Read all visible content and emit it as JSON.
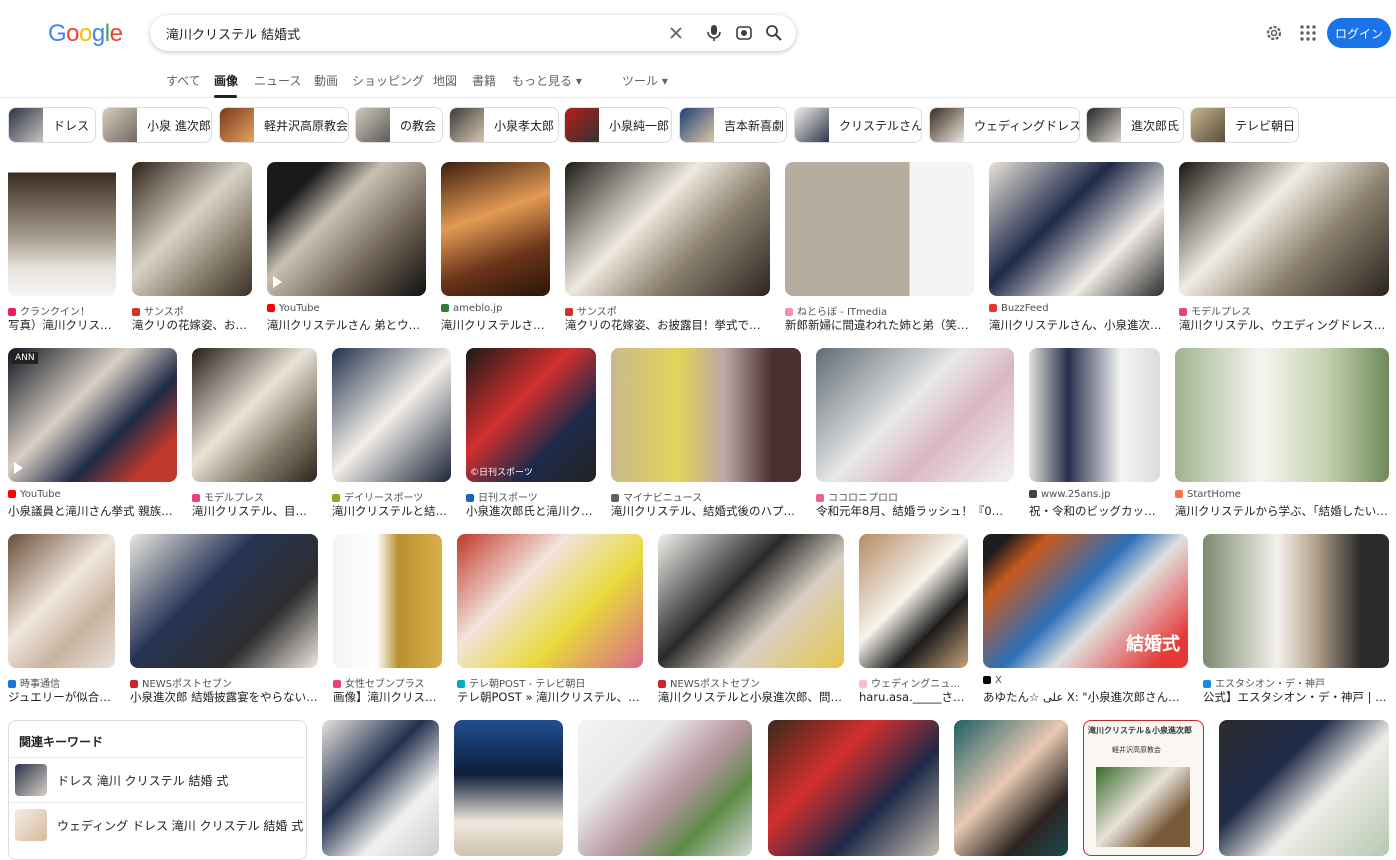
{
  "header": {
    "logo": "Google",
    "search_value": "滝川クリステル 結婚式",
    "login_label": "ログイン"
  },
  "tabs": [
    "すべて",
    "画像",
    "ニュース",
    "動画",
    "ショッピング",
    "地図",
    "書籍",
    "もっと見る ▾",
    "ツール ▾"
  ],
  "chips": [
    "ドレス",
    "小泉 進次郎",
    "軽井沢高原教会",
    "の教会",
    "小泉孝太郎",
    "小泉純一郎",
    "吉本新喜劇",
    "クリステルさん",
    "ウェディングドレス",
    "進次郎氏",
    "テレビ朝日"
  ],
  "results": {
    "row1": [
      {
        "source": "クランクイン！",
        "title": "写真）滝川クリス…"
      },
      {
        "source": "サンスポ",
        "title": "滝クリの花嫁姿、お…"
      },
      {
        "source": "YouTube",
        "title": "滝川クリステルさん 弟とウエ…"
      },
      {
        "source": "ameblo.jp",
        "title": "滝川クリステルさ…"
      },
      {
        "source": "サンスポ",
        "title": "滝クリの花嫁姿、お披露目！挙式で「…"
      },
      {
        "source": "ねとらぼ - ITmedia",
        "title": "新郎新婦に間違われた姉と弟（笑）…"
      },
      {
        "source": "BuzzFeed",
        "title": "滝川クリステルさん、小泉進次…"
      },
      {
        "source": "モデルプレス",
        "title": "滝川クリステル、ウエディングドレス姿…"
      }
    ],
    "row2": [
      {
        "source": "YouTube",
        "title": "小泉議員と滝川さん挙式 親族ら…"
      },
      {
        "source": "モデルプレス",
        "title": "滝川クリステル、目潤…"
      },
      {
        "source": "デイリースポーツ",
        "title": "滝川クリステルと結…"
      },
      {
        "source": "日刊スポーツ",
        "title": "小泉進次郎氏と滝川ク…"
      },
      {
        "source": "マイナビニュース",
        "title": "滝川クリステル、結婚式後のハプニ…"
      },
      {
        "source": "ココロニプロロ",
        "title": "令和元年8月、結婚ラッシュ！『0字…"
      },
      {
        "source": "www.25ans.jp",
        "title": "祝・令和のビッグカッ…"
      },
      {
        "source": "StartHome",
        "title": "滝川クリステルから学ぶ、「結婚したい…"
      }
    ],
    "row3": [
      {
        "source": "時事通信",
        "title": "ジュエリーが似合…"
      },
      {
        "source": "NEWSポストセブン",
        "title": "小泉進次郎 結婚披露宴をやらない…"
      },
      {
        "source": "女性セブンプラス",
        "title": "画像】滝川クリス…"
      },
      {
        "source": "テレ朝POST - テレビ朝日",
        "title": "テレ朝POST » 滝川クリステル、結…"
      },
      {
        "source": "NEWSポストセブン",
        "title": "滝川クリステルと小泉進次郎、問…"
      },
      {
        "source": "ウェディングニュ…",
        "title": "haru.asa._____さん…"
      },
      {
        "source": "X",
        "title": "あゆたん☆ علی X: \"小泉進次郎さん&滝…"
      },
      {
        "source": "エスタシオン・デ・神戸",
        "title": "公式】エスタシオン・デ・神戸 | …"
      }
    ]
  },
  "overlays": {
    "ann": "ANN",
    "nikkan": "©日刊スポーツ",
    "kekkonshiki": "結婚式",
    "row4_card_title": "滝川クリステル＆小泉進次郎",
    "row4_card_sub": "軽井沢高原教会"
  },
  "related": {
    "heading": "関連キーワード",
    "items": [
      "ドレス 滝川 クリステル 結婚 式",
      "ウェディング ドレス 滝川 クリステル 結婚 式"
    ]
  },
  "colors": {
    "accent": "#1a73e8",
    "text": "#202124",
    "muted": "#5f6368"
  }
}
